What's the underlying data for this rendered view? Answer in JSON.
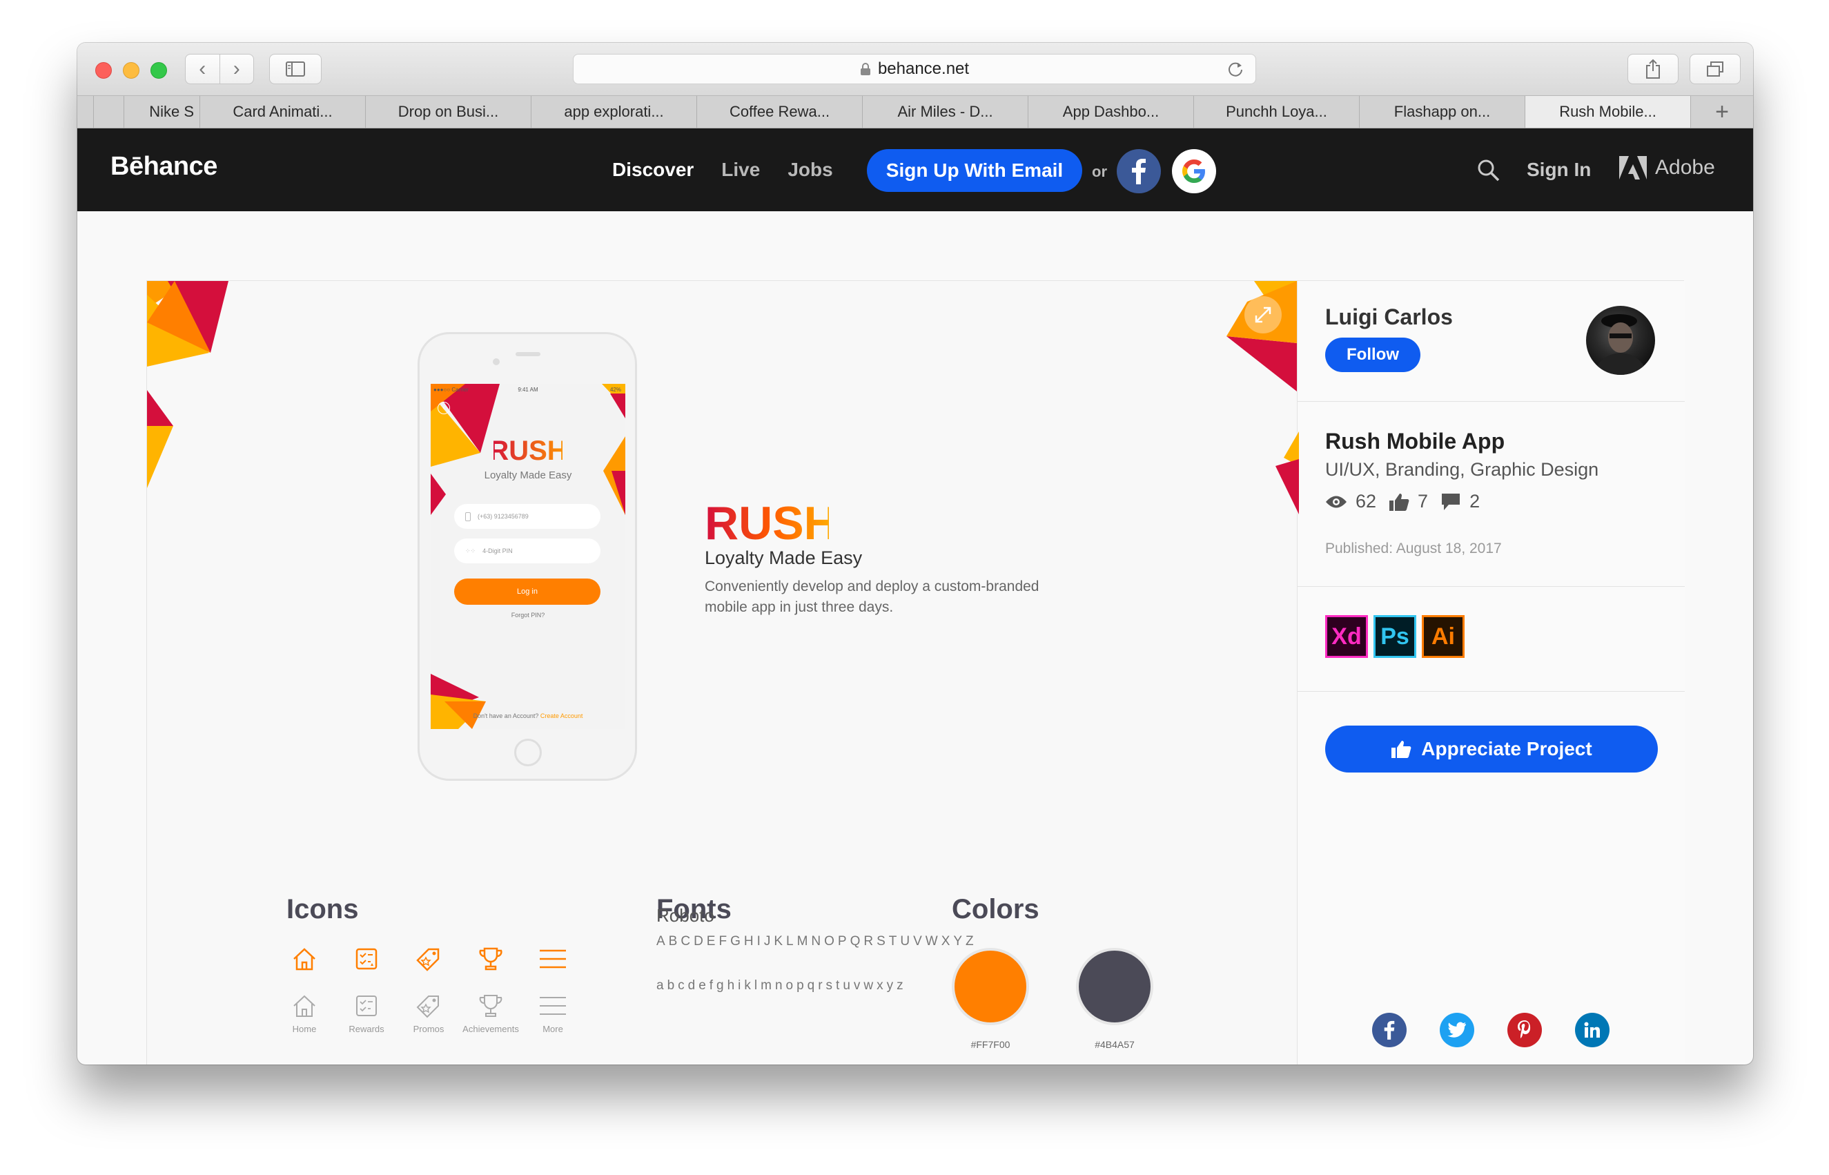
{
  "browser": {
    "url": "behance.net",
    "tabs": [
      {
        "label": "Nike S"
      },
      {
        "label": "Card Animati..."
      },
      {
        "label": "Drop on Busi..."
      },
      {
        "label": "app explorati..."
      },
      {
        "label": "Coffee Rewa..."
      },
      {
        "label": "Air Miles - D..."
      },
      {
        "label": "App Dashbo..."
      },
      {
        "label": "Punchh Loya..."
      },
      {
        "label": "Flashapp on..."
      },
      {
        "label": "Rush Mobile..."
      }
    ],
    "active_tab": 9
  },
  "header": {
    "logo": "Bēhance",
    "nav": {
      "discover": "Discover",
      "live": "Live",
      "jobs": "Jobs"
    },
    "signup": "Sign Up With Email",
    "or": "or",
    "signin": "Sign In",
    "adobe": "Adobe"
  },
  "phone": {
    "time": "9:41 AM",
    "carrier": "●●●○○ Carrier",
    "battery": "42%",
    "brand": "RUSH",
    "tagline": "Loyalty Made Easy",
    "phone_field": "(+63)  9123456789",
    "pin_field": "4-Digit PIN",
    "login": "Log in",
    "forgot": "Forgot PIN?",
    "no_account": "Don't have an Account?",
    "create_account": "Create Account"
  },
  "hero": {
    "brand": "RUSH",
    "tagline": "Loyalty Made Easy",
    "description": "Conveniently develop and deploy a custom-branded mobile app in just three days."
  },
  "sections": {
    "icons_title": "Icons",
    "icon_labels": [
      "Home",
      "Rewards",
      "Promos",
      "Achievements",
      "More"
    ],
    "fonts_title": "Fonts",
    "font_name": "Roboto",
    "font_upper": "ABCDEFGHIJKLMNOPQRSTUVWXYZ",
    "font_lower": "abcdefghiklmnopqrstuvwxyz",
    "colors_title": "Colors",
    "colors": [
      {
        "hex": "#FF7F00",
        "label": "#FF7F00"
      },
      {
        "hex": "#4B4A57",
        "label": "#4B4A57"
      }
    ]
  },
  "sidebar": {
    "owner": "Luigi Carlos",
    "follow": "Follow",
    "project_title": "Rush Mobile App",
    "fields": "UI/UX, Branding, Graphic Design",
    "views": "62",
    "appreciations": "7",
    "comments": "2",
    "published": "Published: August 18, 2017",
    "tools": [
      {
        "name": "Xd",
        "color": "#ff2bc2",
        "bg": "#2e001f"
      },
      {
        "name": "Ps",
        "color": "#31c5f0",
        "bg": "#001d26"
      },
      {
        "name": "Ai",
        "color": "#ff7c00",
        "bg": "#261300"
      }
    ],
    "appreciate": "Appreciate Project"
  },
  "colors": {
    "accent_blue": "#0f5cf0",
    "brand_orange": "#ff7f00",
    "brand_red": "#d40f3c",
    "brand_yellow": "#ffb400",
    "dark": "#191919"
  }
}
